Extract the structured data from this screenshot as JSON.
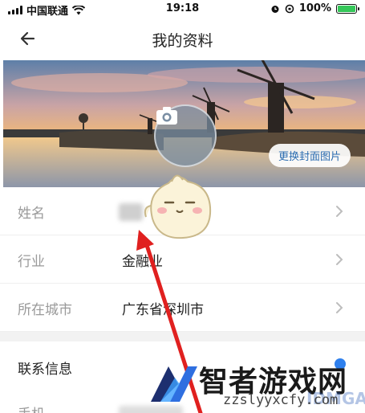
{
  "status_bar": {
    "carrier": "中国联通",
    "time": "19:18",
    "battery_percent": "100%",
    "battery_level": 1.0
  },
  "nav": {
    "title": "我的资料",
    "back_icon": "arrow-left-icon"
  },
  "cover": {
    "change_cover_label": "更换封面图片",
    "camera_icon": "camera-icon"
  },
  "profile_rows": [
    {
      "label": "姓名",
      "value": ""
    },
    {
      "label": "行业",
      "value": "金融业"
    },
    {
      "label": "所在城市",
      "value": "广东省深圳市"
    }
  ],
  "contact_section": {
    "title": "联系信息",
    "next_row_label": "手机"
  },
  "watermark": {
    "title": "智者游戏网",
    "url": "zzslyyxcfy.com",
    "faint_text": "IDMGAME"
  },
  "colors": {
    "accent": "#2b6cb0",
    "battery": "#35c759",
    "annotation_arrow": "#e0201f"
  }
}
